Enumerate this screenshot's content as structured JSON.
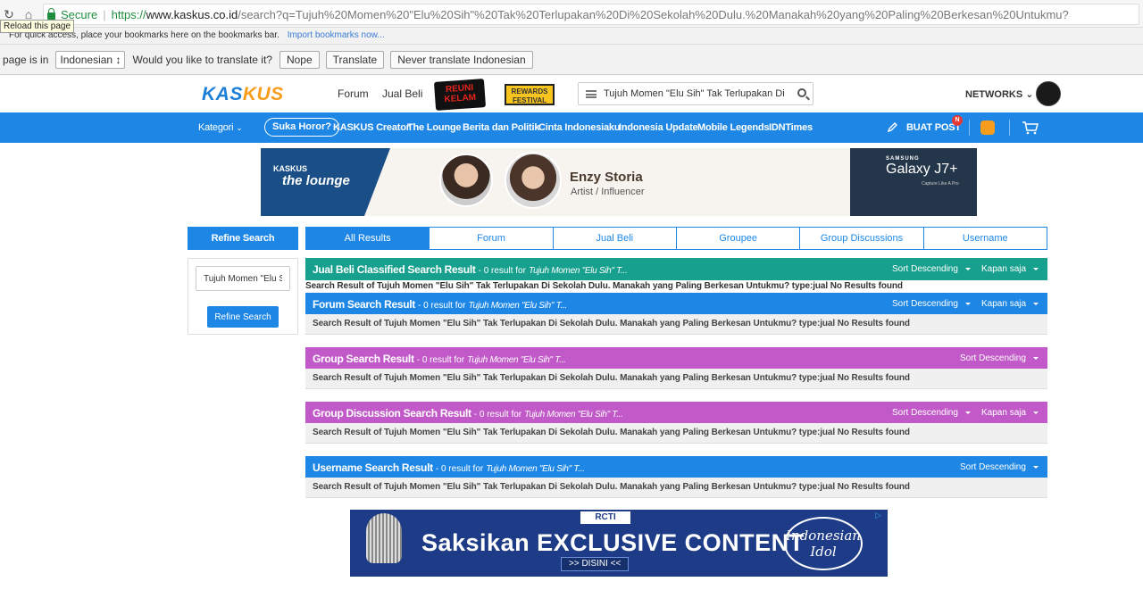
{
  "browser": {
    "secure_label": "Secure",
    "url_scheme": "https://",
    "url_host": "www.kaskus.co.id",
    "url_path": "/search?q=Tujuh%20Momen%20\"Elu%20Sih\"%20Tak%20Terlupakan%20Di%20Sekolah%20Dulu.%20Manakah%20yang%20Paling%20Berkesan%20Untukmu?",
    "tooltip": "Reload this page",
    "bookmarks_text": "For quick access, place your bookmarks here on the bookmarks bar.",
    "bookmarks_link": "Import bookmarks now...",
    "translate": {
      "label": "page is in",
      "language": "Indonesian",
      "question": "Would you like to translate it?",
      "nope": "Nope",
      "translate": "Translate",
      "never": "Never translate Indonesian"
    }
  },
  "header": {
    "logo_a": "KAS",
    "logo_b": "KUS",
    "forum": "Forum",
    "jual_beli": "Jual Beli",
    "reuni_badge": "REUNI KELAM",
    "rewards_badge": "REWARDS FESTIVAL",
    "search_value": "Tujuh Momen \"Elu Sih\" Tak Terlupakan Di Sekolah Dulu",
    "networks": "NETWORKS"
  },
  "nav": {
    "kategori": "Kategori",
    "pill": "Suka Horor?",
    "items": [
      "KASKUS Creator",
      "The Lounge",
      "Berita dan Politik",
      "Cinta Indonesiaku",
      "Indonesia Update",
      "Mobile Legends",
      "IDNTimes"
    ],
    "buat_post": "BUAT POST",
    "notif": "N"
  },
  "banner": {
    "kaskus": "KASKUS",
    "lounge": "the lounge",
    "name": "Enzy Storia",
    "role": "Artist / Influencer",
    "brand": "SAMSUNG",
    "model": "Galaxy J7+",
    "tagline": "Capture Like A Pro"
  },
  "sidebar": {
    "heading": "Refine Search",
    "input_value": "Tujuh Momen \"Elu Sih\"",
    "button": "Refine Search"
  },
  "tabs": [
    "All Results",
    "Forum",
    "Jual Beli",
    "Groupee",
    "Group Discussions",
    "Username"
  ],
  "results": {
    "query_short": "Tujuh Momen \"Elu Sih\" T...",
    "count_text": "- 0 result for",
    "sort_desc": "Sort Descending",
    "kapan": "Kapan saja",
    "body": "Search Result of Tujuh Momen \"Elu Sih\" Tak Terlupakan Di Sekolah Dulu. Manakah yang Paling Berkesan Untukmu? type:jual No Results found",
    "jual_beli_title": "Jual Beli Classified Search Result",
    "forum_title": "Forum Search Result",
    "group_title": "Group Search Result",
    "group_discussion_title": "Group Discussion Search Result",
    "username_title": "Username Search Result"
  },
  "ad": {
    "channel": "RCTI",
    "headline": "Saksikan EXCLUSIVE CONTENT",
    "cta": ">> DISINI <<",
    "show": "Indonesian Idol"
  }
}
